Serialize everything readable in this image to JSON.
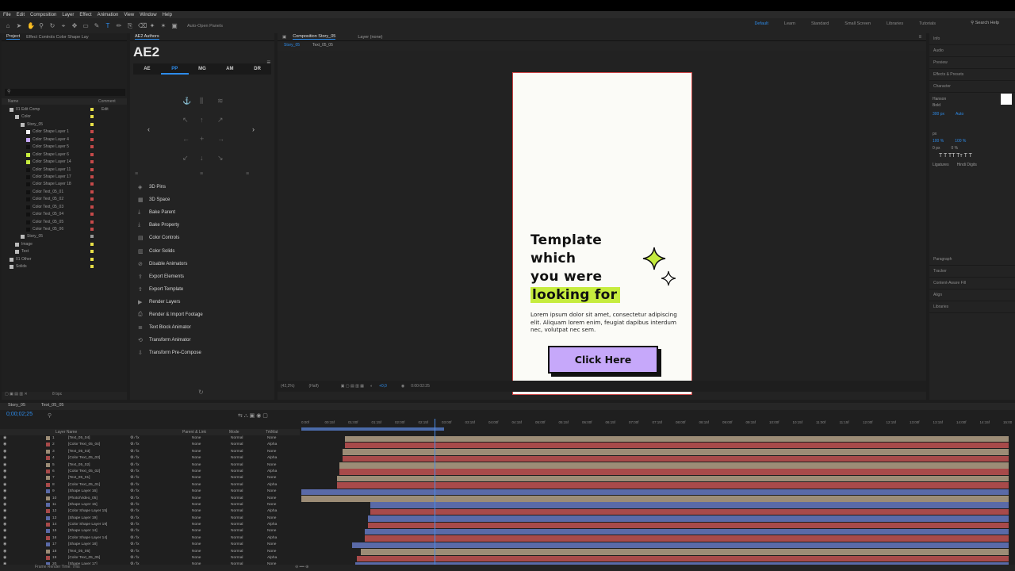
{
  "menu": [
    "File",
    "Edit",
    "Composition",
    "Layer",
    "Effect",
    "Animation",
    "View",
    "Window",
    "Help"
  ],
  "toolbar": {
    "auto_open": "Auto-Open Panels",
    "search_help": "Search Help",
    "workspaces": [
      "Default",
      "Learn",
      "Standard",
      "Small Screen",
      "Libraries",
      "Tutorials"
    ]
  },
  "project": {
    "tabs": [
      "Project",
      "Effect Controls Color Shape Lay"
    ],
    "cols": {
      "name": "Name",
      "comment": "Comment"
    },
    "rows": [
      {
        "t": "01 Edit Comp",
        "d": 0,
        "c": "#bbb",
        "k": "#e8e048",
        "note": "Edit"
      },
      {
        "t": "Color",
        "d": 1,
        "c": "#bbb",
        "k": "#e8e048"
      },
      {
        "t": "Story_05",
        "d": 2,
        "c": "#bbb",
        "k": "#e8e048"
      },
      {
        "t": "Color Shape Layer 1",
        "d": 3,
        "c": "#f4f4f4",
        "k": "#c54a4a"
      },
      {
        "t": "Color Shape Layer 4",
        "d": 3,
        "c": "#c6a8fa",
        "k": "#c54a4a"
      },
      {
        "t": "Color Shape Layer 5",
        "d": 3,
        "c": "#111",
        "k": "#c54a4a"
      },
      {
        "t": "Color Shape Layer 6",
        "d": 3,
        "c": "#c6ec3e",
        "k": "#c54a4a"
      },
      {
        "t": "Color Shape Layer 14",
        "d": 3,
        "c": "#c6ec3e",
        "k": "#c54a4a"
      },
      {
        "t": "Color Shape Layer 11",
        "d": 3,
        "c": "#111",
        "k": "#c54a4a"
      },
      {
        "t": "Color Shape Layer 17",
        "d": 3,
        "c": "#111",
        "k": "#c54a4a"
      },
      {
        "t": "Color Shape Layer 18",
        "d": 3,
        "c": "#111",
        "k": "#c54a4a"
      },
      {
        "t": "Color Text_05_01",
        "d": 3,
        "c": "#111",
        "k": "#c54a4a"
      },
      {
        "t": "Color Text_05_02",
        "d": 3,
        "c": "#111",
        "k": "#c54a4a"
      },
      {
        "t": "Color Text_05_03",
        "d": 3,
        "c": "#111",
        "k": "#c54a4a"
      },
      {
        "t": "Color Text_05_04",
        "d": 3,
        "c": "#111",
        "k": "#c54a4a"
      },
      {
        "t": "Color Text_05_05",
        "d": 3,
        "c": "#111",
        "k": "#c54a4a"
      },
      {
        "t": "Color Text_05_06",
        "d": 3,
        "c": "#111",
        "k": "#c54a4a"
      },
      {
        "t": "Story_05",
        "d": 2,
        "c": "#bbb",
        "k": "#999"
      },
      {
        "t": "Image",
        "d": 1,
        "c": "#bbb",
        "k": "#e8e048"
      },
      {
        "t": "Text",
        "d": 1,
        "c": "#bbb",
        "k": "#e8e048"
      },
      {
        "t": "01 Other",
        "d": 0,
        "c": "#bbb",
        "k": "#e8e048"
      },
      {
        "t": "Solids",
        "d": 0,
        "c": "#bbb",
        "k": "#e8e048"
      }
    ],
    "footer": "8 bpc"
  },
  "ae2": {
    "tab": "AE2 Authors",
    "title": "AE2",
    "tabs": [
      "AE",
      "PP",
      "MG",
      "AM",
      "DR"
    ],
    "active_tab": "PP",
    "items": [
      "3D Pins",
      "3D Space",
      "Bake Parent",
      "Bake Property",
      "Color Controls",
      "Color Solids",
      "Disable Animators",
      "Export Elements",
      "Export Template",
      "Render Layers",
      "Render & Import Footage",
      "Text Block Animator",
      "Transform Animator",
      "Transform Pre-Compose"
    ]
  },
  "comp": {
    "tab": "Composition Story_05",
    "layer_tab": "Layer (none)",
    "crumbs": [
      "Story_05",
      "Text_05_05"
    ],
    "headline": [
      "Template",
      "which",
      "you were",
      "looking for"
    ],
    "body": "Lorem ipsum dolor sit amet, consectetur adipiscing elit. Aliquam lorem enim, feugiat dapibus interdum nec, volutpat nec sem.",
    "cta": "Click Here",
    "zoom": "(42,2%)",
    "res": "(Half)",
    "time": "0:00:02:25",
    "plus": "+0,0"
  },
  "right": {
    "sections": [
      "Info",
      "Audio",
      "Preview",
      "Effects & Presets",
      "Character"
    ],
    "font": "Hanson",
    "style": "Bold",
    "size": "300 px",
    "tracking": "Auto",
    "vscale": "100 %",
    "hscale": "100 %",
    "baseline": "0 px",
    "tsume": "0 %",
    "unit": "px",
    "ligatures": "Ligatures",
    "hindi": "Hindi Digits",
    "more": [
      "Paragraph",
      "Tracker",
      "Content-Aware Fill",
      "Align",
      "Libraries"
    ]
  },
  "timeline": {
    "tabs": [
      "Story_05",
      "Text_05_05"
    ],
    "time": "0;00;02;25",
    "cols": {
      "name": "Layer Name",
      "parent": "Parent & Link",
      "mode": "Mode",
      "trkmat": "TrkMat"
    },
    "ruler": [
      "0:00f",
      "00:15f",
      "01:00f",
      "01:15f",
      "02:00f",
      "02:15f",
      "03:00f",
      "03:15f",
      "04:00f",
      "04:15f",
      "05:00f",
      "05:15f",
      "06:00f",
      "06:15f",
      "07:00f",
      "07:15f",
      "08:00f",
      "08:15f",
      "09:00f",
      "09:15f",
      "10:00f",
      "10:15f",
      "11:00f",
      "11:15f",
      "12:00f",
      "12:15f",
      "13:00f",
      "13:15f",
      "14:00f",
      "14:15f",
      "15:00"
    ],
    "layers": [
      {
        "n": "1",
        "name": "[Text_05_04]",
        "mode": "Normal",
        "trk": "None",
        "c": "#9c8c76",
        "s": 0.062
      },
      {
        "n": "2",
        "name": "[Color Text_05_04]",
        "mode": "Normal",
        "trk": "Alpha",
        "c": "#a84a4a",
        "s": 0.062
      },
      {
        "n": "3",
        "name": "[Text_05_03]",
        "mode": "Normal",
        "trk": "None",
        "c": "#9c8c76",
        "s": 0.058
      },
      {
        "n": "4",
        "name": "[Color Text_05_03]",
        "mode": "Normal",
        "trk": "Alpha",
        "c": "#a84a4a",
        "s": 0.058
      },
      {
        "n": "5",
        "name": "[Text_05_02]",
        "mode": "Normal",
        "trk": "None",
        "c": "#9c8c76",
        "s": 0.054
      },
      {
        "n": "6",
        "name": "[Color Text_05_02]",
        "mode": "Normal",
        "trk": "Alpha",
        "c": "#a84a4a",
        "s": 0.054
      },
      {
        "n": "7",
        "name": "[Text_05_01]",
        "mode": "Normal",
        "trk": "None",
        "c": "#9c8c76",
        "s": 0.05
      },
      {
        "n": "8",
        "name": "[Color Text_05_01]",
        "mode": "Normal",
        "trk": "Alpha",
        "c": "#a84a4a",
        "s": 0.05
      },
      {
        "n": "9",
        "name": "[Shape Layer 16]",
        "mode": "Normal",
        "trk": "None",
        "c": "#5a6aa8",
        "s": 0.0
      },
      {
        "n": "10",
        "name": "[Photo/Video_05]",
        "mode": "Normal",
        "trk": "None",
        "c": "#9c8c76",
        "s": 0.0
      },
      {
        "n": "11",
        "name": "[Shape Layer 15]",
        "mode": "Normal",
        "trk": "None",
        "c": "#5a6aa8",
        "s": 0.098
      },
      {
        "n": "12",
        "name": "[Color Shape Layer 15]",
        "mode": "Normal",
        "trk": "Alpha",
        "c": "#a84a4a",
        "s": 0.098
      },
      {
        "n": "13",
        "name": "[Shape Layer 19]",
        "mode": "Normal",
        "trk": "None",
        "c": "#5a6aa8",
        "s": 0.094
      },
      {
        "n": "14",
        "name": "[Color Shape Layer 19]",
        "mode": "Normal",
        "trk": "Alpha",
        "c": "#a84a4a",
        "s": 0.094
      },
      {
        "n": "15",
        "name": "[Shape Layer 14]",
        "mode": "Normal",
        "trk": "None",
        "c": "#5a6aa8",
        "s": 0.09
      },
      {
        "n": "16",
        "name": "[Color Shape Layer 14]",
        "mode": "Normal",
        "trk": "Alpha",
        "c": "#a84a4a",
        "s": 0.09
      },
      {
        "n": "17",
        "name": "[Shape Layer 18]",
        "mode": "Normal",
        "trk": "None",
        "c": "#5a6aa8",
        "s": 0.072
      },
      {
        "n": "18",
        "name": "[Text_05_05]",
        "mode": "Normal",
        "trk": "None",
        "c": "#9c8c76",
        "s": 0.084
      },
      {
        "n": "19",
        "name": "[Color Text_05_05]",
        "mode": "Normal",
        "trk": "Alpha",
        "c": "#a84a4a",
        "s": 0.078
      },
      {
        "n": "20",
        "name": "[Shape Layer 17]",
        "mode": "Normal",
        "trk": "None",
        "c": "#5a6aa8",
        "s": 0.076
      }
    ],
    "render_time": "Frame Render Time: 7ms"
  }
}
